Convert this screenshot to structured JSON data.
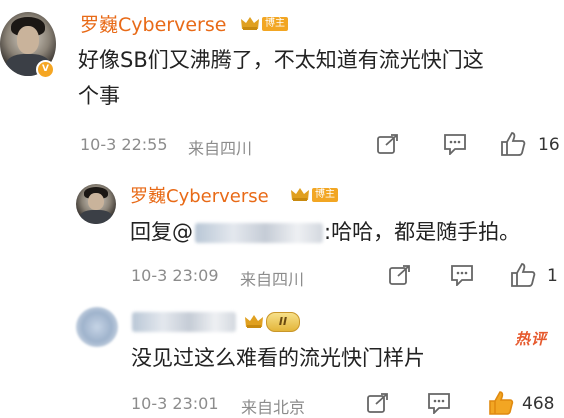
{
  "comments": [
    {
      "username": "罗巍Cyberverse",
      "badge": "博主",
      "verified_badge": "V",
      "text_line1": "好像SB们又沸腾了，不太知道有流光快门这",
      "text_line2": "个事",
      "time": "10-3 22:55",
      "location": "来自四川",
      "likes": "16"
    },
    {
      "username": "罗巍Cyberverse",
      "badge": "博主",
      "reply_prefix": "回复@",
      "reply_text": ":哈哈，都是随手拍。",
      "time": "10-3 23:09",
      "location": "来自四川",
      "likes": "1"
    },
    {
      "level_badge": "II",
      "hot_label": "热评",
      "text": "没见过这么难看的流光快门样片",
      "time": "10-3 23:01",
      "location": "来自北京",
      "likes": "468"
    }
  ],
  "colors": {
    "accent": "#e86a17",
    "badge": "#f2a623",
    "hot": "#e65a2e",
    "meta": "#8c8c8c"
  },
  "icons": [
    "share-icon",
    "comment-icon",
    "thumbs-up-icon",
    "crown-icon",
    "verified-icon"
  ]
}
